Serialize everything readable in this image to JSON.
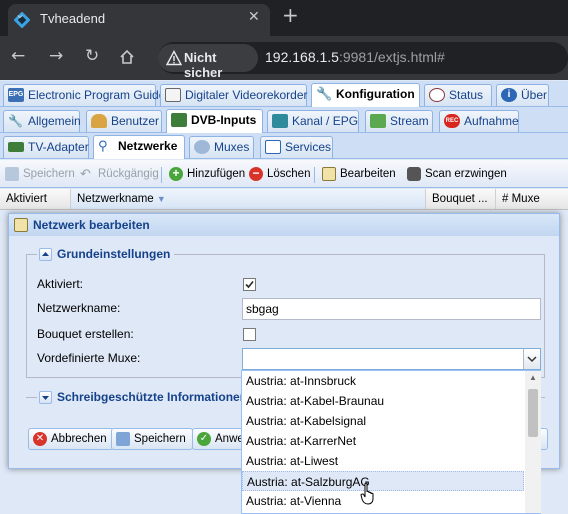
{
  "browser": {
    "tab_title": "Tvheadend",
    "security_label": "Nicht sicher",
    "url_host": "192.168.1.5",
    "url_rest": ":9981/extjs.html#"
  },
  "main_tabs": [
    {
      "label": "Electronic Program Guide",
      "icon": "epg-icon"
    },
    {
      "label": "Digitaler Videorekorder",
      "icon": "dvr-icon"
    },
    {
      "label": "Konfiguration",
      "icon": "wrench-icon",
      "active": true
    },
    {
      "label": "Status",
      "icon": "eye-icon"
    },
    {
      "label": "Über",
      "icon": "info-icon"
    }
  ],
  "config_tabs": [
    {
      "label": "Allgemein"
    },
    {
      "label": "Benutzer"
    },
    {
      "label": "DVB-Inputs",
      "active": true
    },
    {
      "label": "Kanal / EPG"
    },
    {
      "label": "Stream"
    },
    {
      "label": "Aufnahme"
    }
  ],
  "dvb_tabs": [
    {
      "label": "TV-Adapter"
    },
    {
      "label": "Netzwerke",
      "active": true
    },
    {
      "label": "Muxes"
    },
    {
      "label": "Services"
    }
  ],
  "toolbar": {
    "save": "Speichern",
    "undo": "Rückgängig",
    "add": "Hinzufügen",
    "delete": "Löschen",
    "edit": "Bearbeiten",
    "force_scan": "Scan erzwingen"
  },
  "grid": {
    "columns": [
      "Aktiviert",
      "Netzwerkname",
      "Bouquet ...",
      "# Muxe"
    ]
  },
  "dialog": {
    "title": "Netzwerk bearbeiten",
    "basic_section": "Grundeinstellungen",
    "fields": {
      "enabled_label": "Aktiviert:",
      "enabled_checked": true,
      "name_label": "Netzwerkname:",
      "name_value": "sbgag",
      "bouquet_label": "Bouquet erstellen:",
      "bouquet_checked": false,
      "muxes_label": "Vordefinierte Muxe:",
      "muxes_value": ""
    },
    "readonly_section": "Schreibgeschützte Informationen",
    "buttons": {
      "cancel": "Abbrechen",
      "save": "Speichern",
      "apply": "Anwe"
    }
  },
  "dropdown": {
    "items": [
      "Austria: at-Innsbruck",
      "Austria: at-Kabel-Braunau",
      "Austria: at-Kabelsignal",
      "Austria: at-KarrerNet",
      "Austria: at-Liwest",
      "Austria: at-SalzburgAG",
      "Austria: at-Vienna"
    ],
    "highlighted_index": 5
  },
  "colors": {
    "ext_blue_bg": "#dfe8f6",
    "ext_title": "#15428b",
    "chrome_dark": "#202124"
  }
}
